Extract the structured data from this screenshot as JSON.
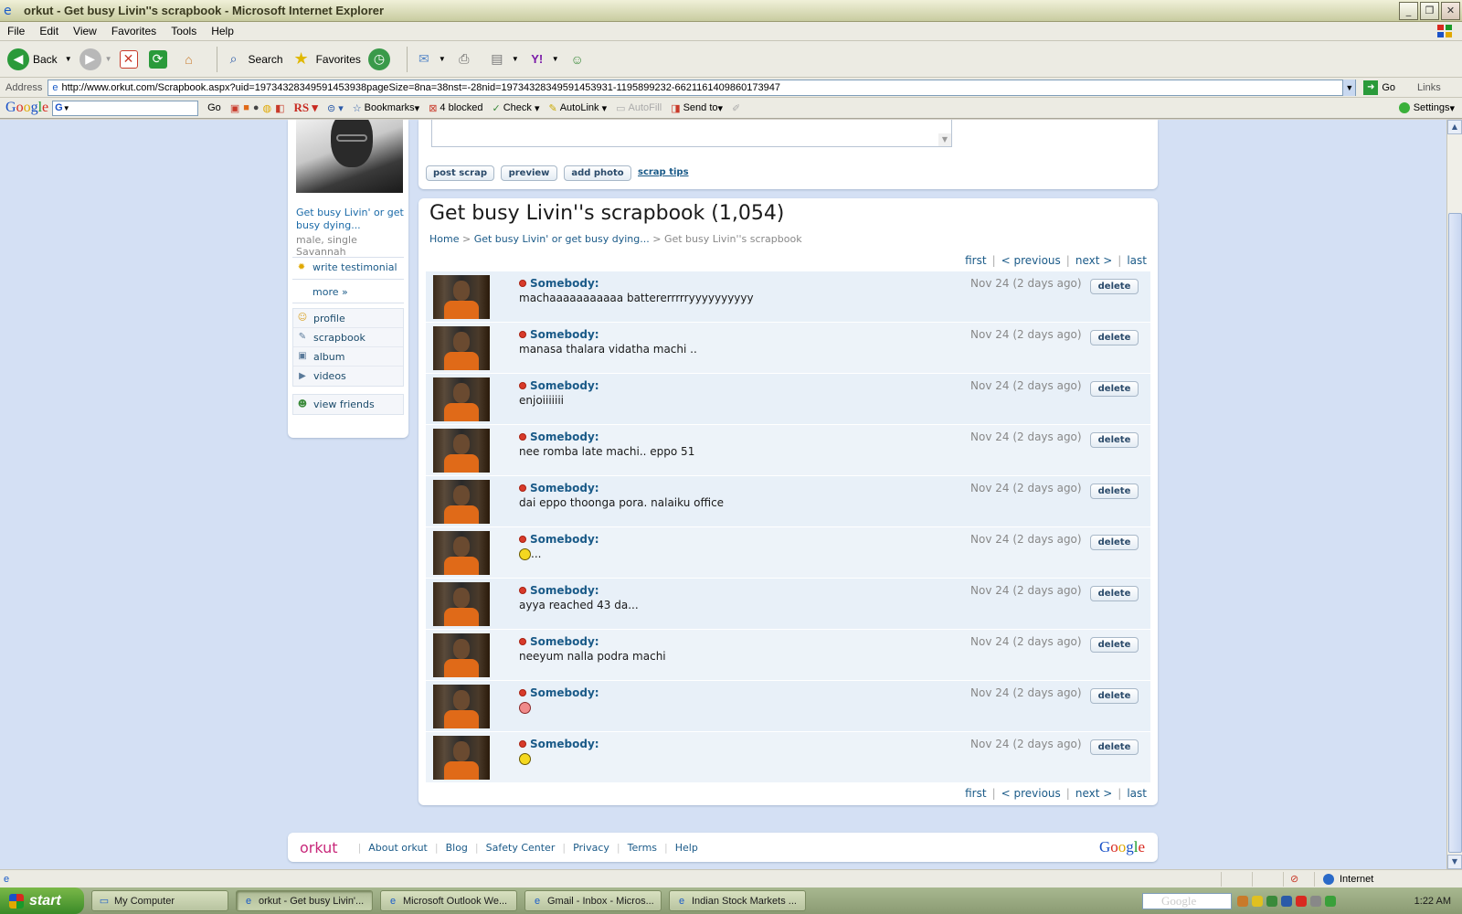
{
  "window": {
    "title": "orkut - Get busy Livin''s scrapbook - Microsoft Internet Explorer",
    "min": "_",
    "max": "❐",
    "close": "✕"
  },
  "menu": [
    "File",
    "Edit",
    "View",
    "Favorites",
    "Tools",
    "Help"
  ],
  "toolbar": {
    "back": "Back",
    "search": "Search",
    "favorites": "Favorites"
  },
  "address": {
    "label": "Address",
    "url": "http://www.orkut.com/Scrapbook.aspx?uid=19734328349591453938pageSize=8na=38nst=-28nid=19734328349591453931-1195899232-6621161409860173947",
    "go": "Go",
    "links": "Links"
  },
  "googlebar": {
    "go": "Go",
    "bookmarks": "Bookmarks",
    "blocked": "4 blocked",
    "check": "Check",
    "autolink": "AutoLink",
    "autofill": "AutoFill",
    "sendto": "Send to",
    "settings": "Settings"
  },
  "profile": {
    "name": "Get busy Livin' or get busy dying...",
    "gender": "male, single",
    "location": "Savannah",
    "write_testimonial": "write testimonial",
    "more": "more »",
    "nav": [
      "profile",
      "scrapbook",
      "album",
      "videos"
    ],
    "view_friends": "view friends"
  },
  "post": {
    "post_scrap": "post scrap",
    "preview": "preview",
    "add_photo": "add photo",
    "scrap_tips": "scrap tips"
  },
  "scrapbook": {
    "title": "Get busy Livin''s scrapbook (1,054)",
    "breadcrumb_home": "Home",
    "breadcrumb_profile": "Get busy Livin' or get busy dying...",
    "breadcrumb_current": "Get busy Livin''s scrapbook",
    "pager": {
      "first": "first",
      "previous": "< previous",
      "next": "next >",
      "last": "last"
    },
    "delete_label": "delete",
    "scraps": [
      {
        "author": "Somebody:",
        "date": "Nov 24 (2 days ago)",
        "text": "machaaaaaaaaaaa battererrrrryyyyyyyyyy"
      },
      {
        "author": "Somebody:",
        "date": "Nov 24 (2 days ago)",
        "text": "manasa thalara vidatha machi .."
      },
      {
        "author": "Somebody:",
        "date": "Nov 24 (2 days ago)",
        "text": "enjoiiiiiii"
      },
      {
        "author": "Somebody:",
        "date": "Nov 24 (2 days ago)",
        "text": "nee romba late machi.. eppo 51"
      },
      {
        "author": "Somebody:",
        "date": "Nov 24 (2 days ago)",
        "text": "dai eppo thoonga pora. nalaiku office"
      },
      {
        "author": "Somebody:",
        "date": "Nov 24 (2 days ago)",
        "text": "...",
        "emoji": "grin"
      },
      {
        "author": "Somebody:",
        "date": "Nov 24 (2 days ago)",
        "text": "ayya reached 43 da..."
      },
      {
        "author": "Somebody:",
        "date": "Nov 24 (2 days ago)",
        "text": "neeyum nalla podra machi"
      },
      {
        "author": "Somebody:",
        "date": "Nov 24 (2 days ago)",
        "text": "",
        "emoji": "sad"
      },
      {
        "author": "Somebody:",
        "date": "Nov 24 (2 days ago)",
        "text": "",
        "emoji": "grin"
      }
    ]
  },
  "footer": {
    "logo": "orkut",
    "links": [
      "About orkut",
      "Blog",
      "Safety Center",
      "Privacy",
      "Terms",
      "Help"
    ]
  },
  "status": {
    "zone": "Internet"
  },
  "taskbar": {
    "start": "start",
    "tasks": [
      "My Computer",
      "orkut - Get busy Livin'...",
      "Microsoft Outlook We...",
      "Gmail - Inbox - Micros...",
      "Indian Stock Markets ..."
    ],
    "clock": "1:22 AM"
  }
}
